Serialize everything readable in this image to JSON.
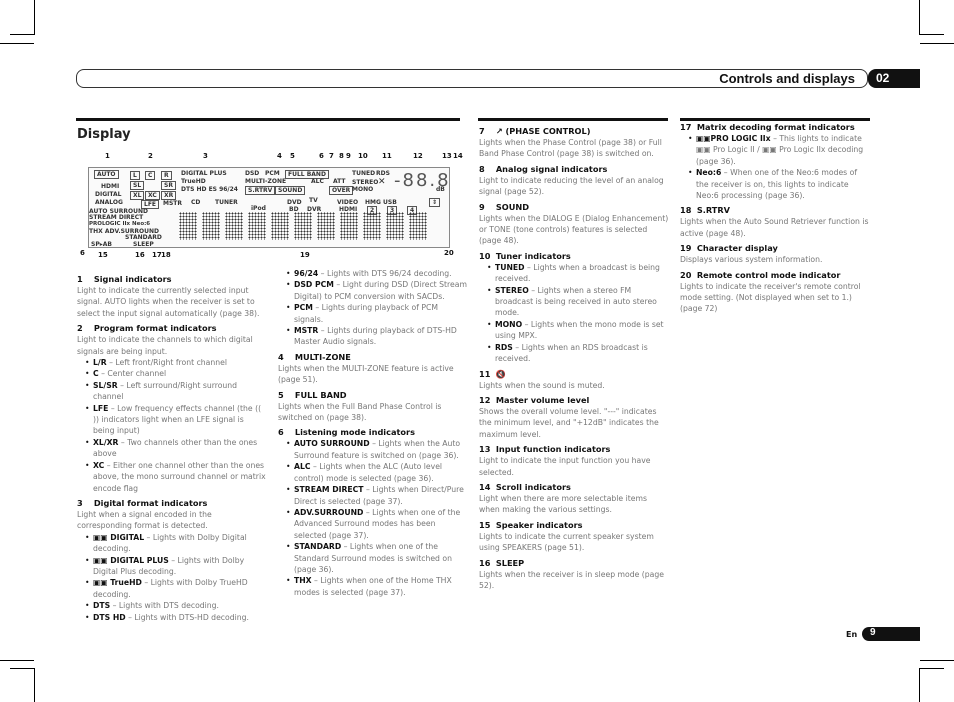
{
  "header": {
    "title": "Controls and displays",
    "chapter": "02"
  },
  "section": {
    "title": "Display"
  },
  "diagram": {
    "callouts_top": [
      "1",
      "2",
      "3",
      "4",
      "5",
      "6",
      "7",
      "8",
      "9",
      "10",
      "11",
      "12",
      "13",
      "14"
    ],
    "callouts_bottom": [
      "6",
      "15",
      "16",
      "17",
      "18",
      "19",
      "20"
    ],
    "labels": {
      "auto": "AUTO",
      "hdmi": "HDMI",
      "digital": "DIGITAL",
      "analog": "ANALOG",
      "ch_l": "L",
      "ch_c": "C",
      "ch_r": "R",
      "ch_sl": "SL",
      "ch_sr": "SR",
      "ch_xl": "XL",
      "ch_xc": "XC",
      "ch_xr": "XR",
      "lfe": "LFE",
      "mstr": "MSTR",
      "digital_plus": "DIGITAL PLUS",
      "truehd": "TrueHD",
      "dts_line": "DTS HD  ES  96/24",
      "dsd": "DSD",
      "pcm": "PCM",
      "multizone": "MULTI-ZONE",
      "srtrv": "S.RTRV",
      "full_band": "FULL BAND",
      "alc": "ALC",
      "att": "ATT",
      "over": "OVER",
      "sound": "SOUND",
      "tuned": "TUNED",
      "rds": "RDS",
      "stereo": "STEREO",
      "mono": "MONO",
      "db": "dB",
      "auto_surround": "AUTO SURROUND",
      "stream_direct": "STREAM DIRECT",
      "prologic": "PROLOGIC IIx Neo:6",
      "thx_adv": "THX  ADV.SURROUND",
      "standard": "STANDARD",
      "spab": "SP▸AB",
      "sleep": "SLEEP",
      "cd": "CD",
      "tuner": "TUNER",
      "ipod": "iPod",
      "dvd": "DVD",
      "bd": "BD",
      "tv": "TV",
      "dvr": "DVR",
      "video": "VIDEO",
      "hdmi2": "HDMI",
      "hmg": "HMG",
      "usb": "USB",
      "r2": "2",
      "r3": "3",
      "r4": "4"
    }
  },
  "col1": [
    {
      "num": "1",
      "title": "Signal indicators",
      "text": "Light to indicate the currently selected input signal. AUTO lights when the receiver is set to select the input signal automatically (page 38)."
    },
    {
      "num": "2",
      "title": "Program format indicators",
      "text": "Light to indicate the channels to which digital signals are being input.",
      "bullets": [
        {
          "b": "L/R",
          "t": " – Left front/Right front channel"
        },
        {
          "b": "C",
          "t": " – Center channel"
        },
        {
          "b": "SL/SR",
          "t": " – Left surround/Right surround channel"
        },
        {
          "b": "LFE",
          "t": " – Low frequency effects channel (the (( )) indicators light when an LFE signal is being input)"
        },
        {
          "b": "XL/XR",
          "t": " – Two channels other than the ones above"
        },
        {
          "b": "XC",
          "t": " – Either one channel other than the ones above, the mono surround channel or matrix encode flag"
        }
      ]
    },
    {
      "num": "3",
      "title": "Digital format indicators",
      "text": "Light when a signal encoded in the corresponding format is detected.",
      "bullets": [
        {
          "b": "▣▣ DIGITAL",
          "t": " – Lights with Dolby Digital decoding."
        },
        {
          "b": "▣▣ DIGITAL PLUS",
          "t": " – Lights with Dolby Digital Plus decoding."
        },
        {
          "b": "▣▣ TrueHD",
          "t": " – Lights with Dolby TrueHD decoding."
        },
        {
          "b": "DTS",
          "t": " – Lights with DTS decoding."
        },
        {
          "b": "DTS HD",
          "t": " – Lights with DTS-HD decoding."
        }
      ]
    }
  ],
  "col2": [
    {
      "bullets": [
        {
          "b": "96/24",
          "t": " – Lights with DTS 96/24 decoding."
        },
        {
          "b": "DSD PCM",
          "t": " – Light during DSD (Direct Stream Digital) to PCM conversion with SACDs."
        },
        {
          "b": "PCM",
          "t": " – Lights during playback of PCM signals."
        },
        {
          "b": "MSTR",
          "t": " – Lights during playback of DTS-HD Master Audio signals."
        }
      ]
    },
    {
      "num": "4",
      "title": "MULTI-ZONE",
      "text": "Lights when the MULTI-ZONE feature is active (page 51)."
    },
    {
      "num": "5",
      "title": "FULL BAND",
      "text": "Lights when the Full Band Phase Control is switched on (page 38)."
    },
    {
      "num": "6",
      "title": "Listening mode indicators",
      "bullets": [
        {
          "b": "AUTO SURROUND",
          "t": " – Lights when the Auto Surround feature is switched on (page 36)."
        },
        {
          "b": "ALC",
          "t": " – Lights when the ALC (Auto level control) mode is selected (page 36)."
        },
        {
          "b": "STREAM DIRECT",
          "t": " – Lights when Direct/Pure Direct is selected (page 37)."
        },
        {
          "b": "ADV.SURROUND",
          "t": " – Lights when one of the Advanced Surround modes has been selected (page 37)."
        },
        {
          "b": "STANDARD",
          "t": " – Lights when one of the Standard Surround modes is switched on (page 36)."
        },
        {
          "b": "THX",
          "t": " – Lights when one of the Home THX modes is selected (page 37)."
        }
      ]
    }
  ],
  "col3": [
    {
      "num": "7",
      "title": "↗ (PHASE CONTROL)",
      "text": "Lights when the Phase Control (page 38) or Full Band Phase Control (page 38) is switched on."
    },
    {
      "num": "8",
      "title": "Analog signal indicators",
      "text": "Light to indicate reducing the level of an analog signal (page 52)."
    },
    {
      "num": "9",
      "title": "SOUND",
      "text": "Lights when the DIALOG E (Dialog Enhancement) or TONE (tone controls) features is selected (page 48)."
    },
    {
      "num": "10",
      "title": "Tuner indicators",
      "bullets": [
        {
          "b": "TUNED",
          "t": " – Lights when a broadcast is being received."
        },
        {
          "b": "STEREO",
          "t": " – Lights when a stereo FM broadcast is being received in auto stereo mode."
        },
        {
          "b": "MONO",
          "t": " – Lights when the mono mode is set using MPX."
        },
        {
          "b": "RDS",
          "t": " – Lights when an RDS broadcast is received."
        }
      ]
    },
    {
      "num": "11",
      "title": "🔇",
      "text": "Lights when the sound is muted."
    },
    {
      "num": "12",
      "title": "Master volume level",
      "text": "Shows the overall volume level. \"---\" indicates the minimum level, and \"+12dB\" indicates the maximum level."
    },
    {
      "num": "13",
      "title": "Input function indicators",
      "text": "Light to indicate the input function you have selected."
    },
    {
      "num": "14",
      "title": "Scroll indicators",
      "text": "Light when there are more selectable items when making the various settings."
    },
    {
      "num": "15",
      "title": "Speaker indicators",
      "text": "Lights to indicate the current speaker system using SPEAKERS (page 51)."
    },
    {
      "num": "16",
      "title": "SLEEP",
      "text": "Lights when the receiver is in sleep mode (page 52)."
    }
  ],
  "col4": [
    {
      "num": "17",
      "title": "Matrix decoding format indicators",
      "bullets": [
        {
          "b": "▣▣PRO LOGIC IIx",
          "t": " – This lights to indicate ▣▣ Pro Logic II / ▣▣ Pro Logic IIx decoding (page 36)."
        },
        {
          "b": "Neo:6",
          "t": " – When one of the Neo:6 modes of the receiver is on, this lights to indicate Neo:6 processing (page 36)."
        }
      ]
    },
    {
      "num": "18",
      "title": "S.RTRV",
      "text": "Lights when the Auto Sound Retriever function is active (page 48)."
    },
    {
      "num": "19",
      "title": "Character display",
      "text": "Displays various system information."
    },
    {
      "num": "20",
      "title": "Remote control mode indicator",
      "text": "Lights to indicate the receiver's remote control mode setting. (Not displayed when set to 1.) (page 72)"
    }
  ],
  "footer": {
    "lang": "En",
    "page": "9"
  }
}
